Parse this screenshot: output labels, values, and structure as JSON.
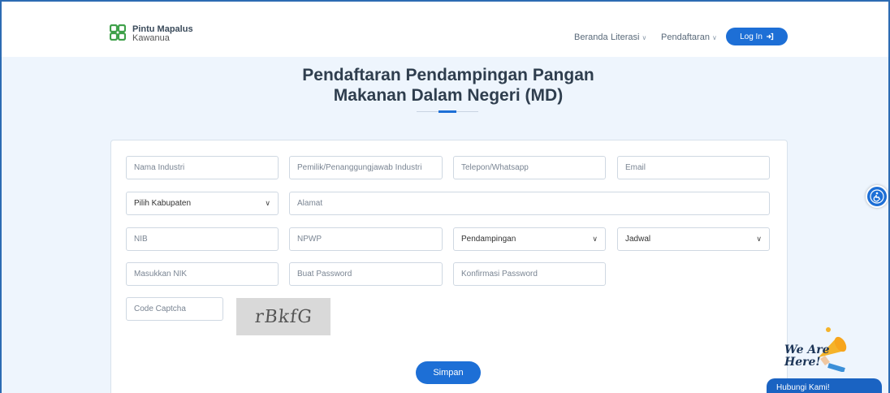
{
  "brand": {
    "line1": "Pintu Mapalus",
    "line2": "Kawanua"
  },
  "nav": {
    "home": "Beranda",
    "literasi": "Literasi",
    "pendaftaran": "Pendaftaran",
    "login": "Log In"
  },
  "page": {
    "title_line1": "Pendaftaran Pendampingan Pangan",
    "title_line2": "Makanan Dalam Negeri (MD)"
  },
  "form": {
    "nama_industri": "Nama Industri",
    "pemilik": "Pemilik/Penanggungjawab Industri",
    "telepon": "Telepon/Whatsapp",
    "email": "Email",
    "kabupaten": "Pilih Kabupaten",
    "alamat": "Alamat",
    "nib": "NIB",
    "npwp": "NPWP",
    "pendampingan": "Pendampingan",
    "jadwal": "Jadwal",
    "nik": "Masukkan NIK",
    "password": "Buat Password",
    "konfirmasi": "Konfirmasi Password",
    "captcha_input": "Code Captcha",
    "captcha_text": "rBkfG",
    "submit": "Simpan"
  },
  "chat": {
    "badge_line1": "We Are",
    "badge_line2": "Here!",
    "button": "Hubungi Kami!"
  },
  "colors": {
    "primary": "#1d6fd6",
    "background": "#eef5fd",
    "frame": "#2c6bb3"
  },
  "icons": {
    "accessibility": "accessibility-icon",
    "login": "login-arrow-icon",
    "chevron": "chevron-down-icon"
  }
}
